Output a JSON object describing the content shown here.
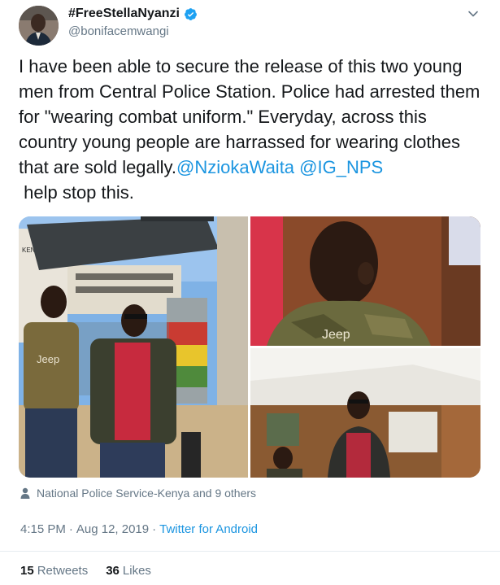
{
  "author": {
    "display_name": "#FreeStellaNyanzi",
    "handle": "@bonifacemwangi",
    "verified_icon": "verified-badge-icon",
    "avatar_icon": "profile-avatar"
  },
  "tweet": {
    "text_plain": "I have been able to secure the release of this two young men from Central Police Station. Police had arrested them for \"wearing combat uniform.\" Everyday, across this country young people are harrassed for wearing clothes that are sold legally.",
    "mention_1": "@NziokaWaita",
    "mention_2": "@IG_NPS",
    "text_tail": "help stop this."
  },
  "media": {
    "photos": [
      {
        "id": "photo-1",
        "shirt_text": "Jeep",
        "sign_text": "KENYA"
      },
      {
        "id": "photo-2",
        "shirt_text": "Jeep"
      },
      {
        "id": "photo-3"
      }
    ]
  },
  "tagged": {
    "icon": "person-icon",
    "text": "National Police Service-Kenya and 9 others"
  },
  "meta": {
    "time": "4:15 PM",
    "separator": "·",
    "date": "Aug 12, 2019",
    "separator2": "·",
    "source": "Twitter for Android"
  },
  "stats": {
    "retweets_count": "15",
    "retweets_label": "Retweets",
    "likes_count": "36",
    "likes_label": "Likes"
  },
  "colors": {
    "link": "#1b95e0",
    "secondary_text": "#657786",
    "primary_text": "#14171a",
    "verified": "#1da1f2"
  }
}
